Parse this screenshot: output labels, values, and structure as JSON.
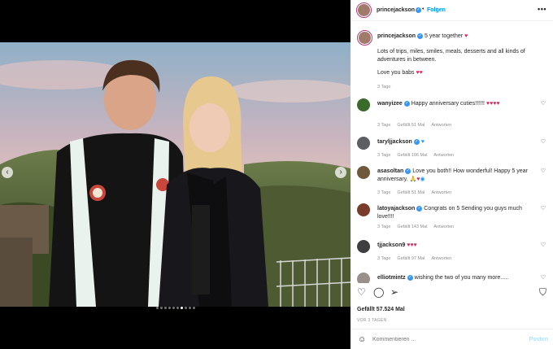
{
  "post": {
    "image_alt": "",
    "carousel_count": 10,
    "carousel_active": 7
  },
  "header": {
    "username": "princejackson",
    "separator": "•",
    "follow_label": "Folgen",
    "more_icon": "more-horizontal-icon"
  },
  "caption": {
    "username": "princejackson",
    "text1": "5 year together",
    "text2": "Lots of trips, miles, smiles, meals, desserts and all kinds of adventures in between.",
    "text3": "Love you babs",
    "time": "3 Tage"
  },
  "comments": [
    {
      "username": "wanyizee",
      "text": "Happy anniversary cuties!!!!!!",
      "time": "3 Tage",
      "likes": "Gefällt 51 Mal",
      "reply": "Antworten",
      "avatar_color": "#3a6b2a"
    },
    {
      "username": "taryljjackson",
      "text": "",
      "time": "3 Tage",
      "likes": "Gefällt 106 Mal",
      "reply": "Antworten",
      "avatar_color": "#5b5f63"
    },
    {
      "username": "asasoltan",
      "text": "Love you both!! How wonderful! Happy 5 year anniversary.",
      "time": "3 Tage",
      "likes": "Gefällt 51 Mal",
      "reply": "Antworten",
      "avatar_color": "#6e5a3a"
    },
    {
      "username": "latoyajackson",
      "text": "Congrats on 5 Sending you guys much love!!!!",
      "time": "3 Tage",
      "likes": "Gefällt 143 Mal",
      "reply": "Antworten",
      "avatar_color": "#7a3b2c"
    },
    {
      "username": "tjjackson9",
      "text": "",
      "time": "3 Tage",
      "likes": "Gefällt 97 Mal",
      "reply": "Antworten",
      "avatar_color": "#3e3e3e"
    },
    {
      "username": "elliotmintz",
      "text": "wishing the two of you many more.....",
      "time": "",
      "likes": "",
      "reply": "",
      "avatar_color": "#9a8f8a"
    }
  ],
  "actions": {
    "like_icon": "heart-icon",
    "comment_icon": "comment-icon",
    "share_icon": "share-icon",
    "save_icon": "bookmark-icon"
  },
  "likes_text": "Gefällt 57.524 Mal",
  "date_text": "VOR 3 TAGEN",
  "add_comment": {
    "placeholder": "Kommentieren ...",
    "post_label": "Posten",
    "emoji_icon": "smiley-icon"
  },
  "colors": {
    "link_blue": "#0095f6",
    "heart_red": "#e0245e",
    "verified_blue": "#3897f0",
    "meta_gray": "#8e8e8e"
  }
}
